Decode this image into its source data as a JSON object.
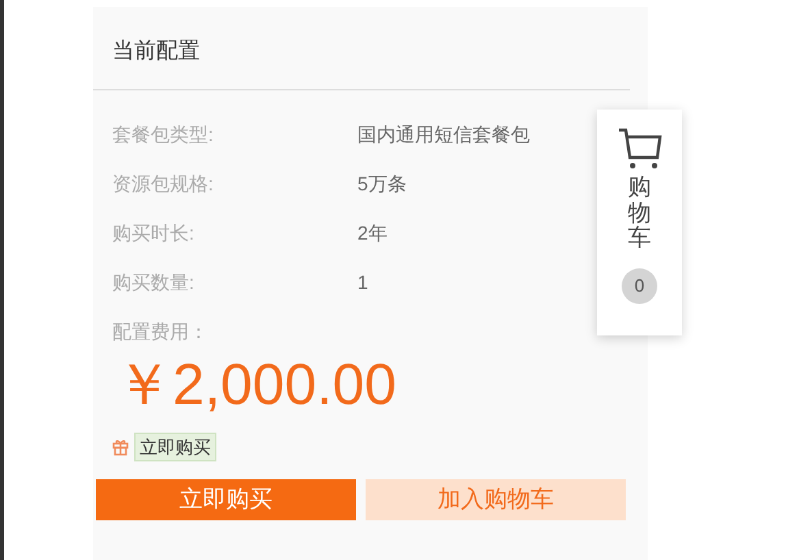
{
  "panel": {
    "title": "当前配置",
    "rows": [
      {
        "label": "套餐包类型:",
        "value": "国内通用短信套餐包"
      },
      {
        "label": "资源包规格:",
        "value": "5万条"
      },
      {
        "label": "购买时长:",
        "value": "2年"
      },
      {
        "label": "购买数量:",
        "value": "1"
      }
    ],
    "fee_label": "配置费用：",
    "price": "￥2,000.00",
    "promo_tag": "立即购买",
    "buttons": [
      {
        "label": "立即购买",
        "kind": "primary"
      },
      {
        "label": "加入购物车",
        "kind": "secondary"
      }
    ]
  },
  "cart": {
    "label": "购物车",
    "count": "0"
  }
}
